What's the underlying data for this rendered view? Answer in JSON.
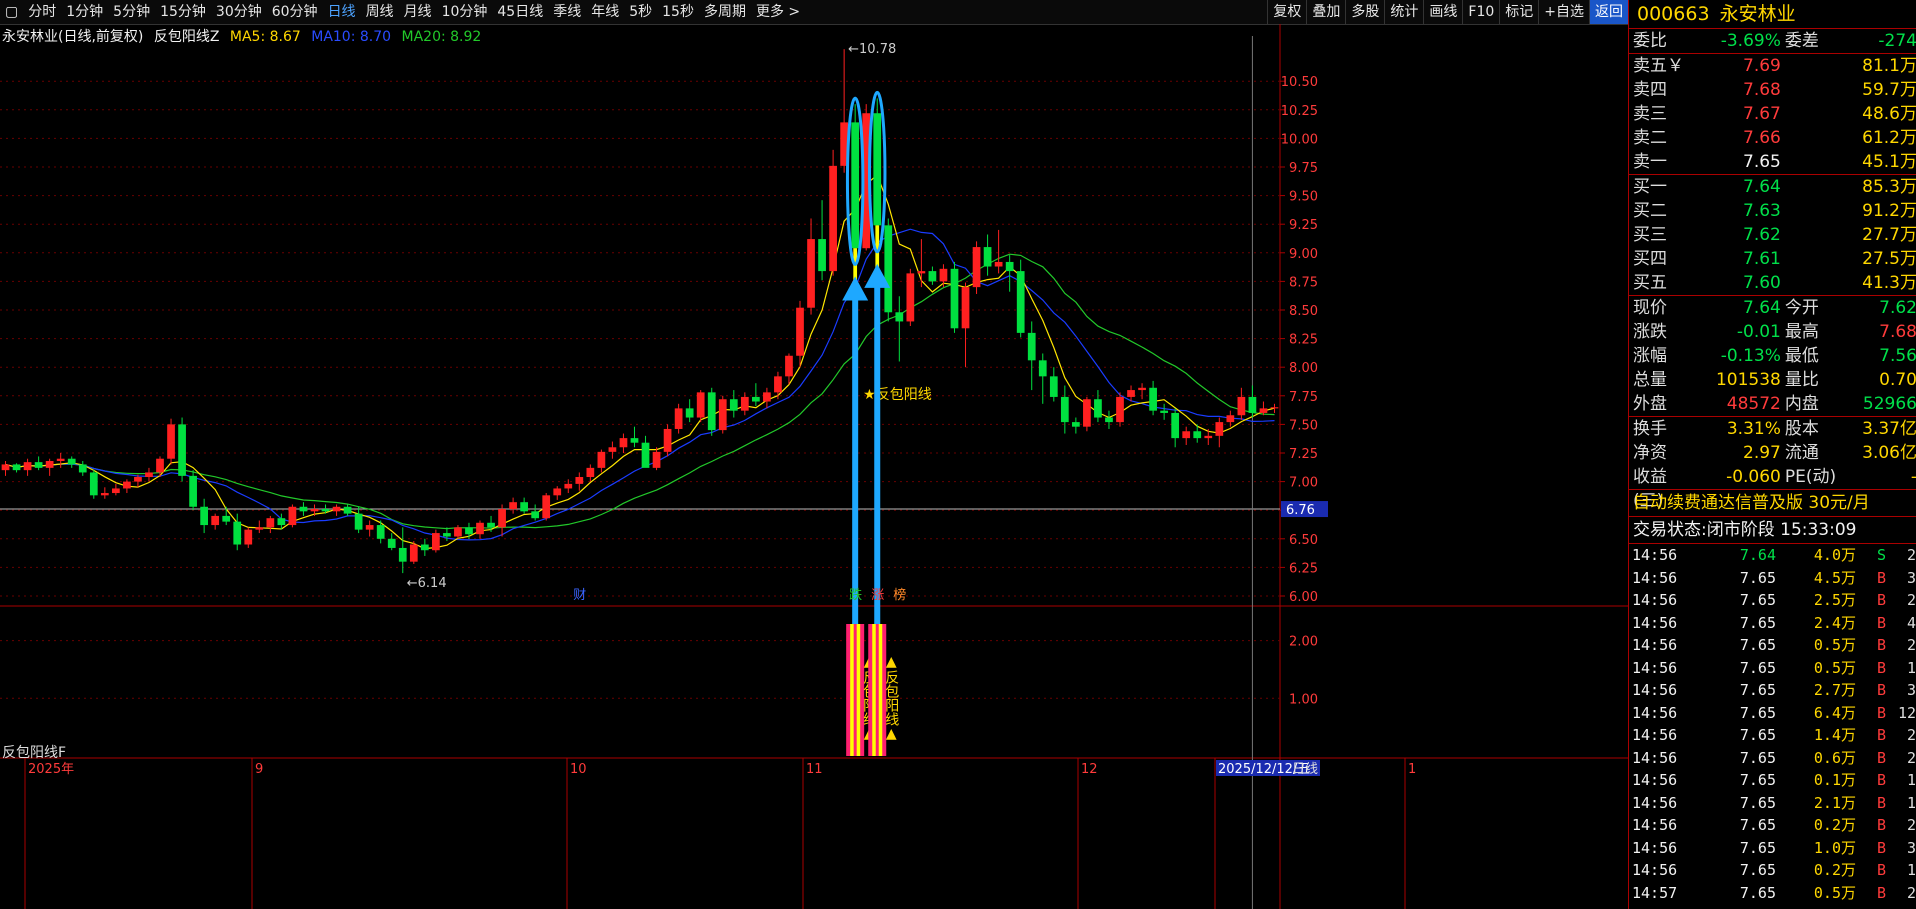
{
  "toolbar": {
    "menu_icon": "▢",
    "periods": [
      "分时",
      "1分钟",
      "5分钟",
      "15分钟",
      "30分钟",
      "60分钟",
      "日线",
      "周线",
      "月线",
      "10分钟",
      "45日线",
      "季线",
      "年线",
      "5秒",
      "15秒",
      "多周期",
      "更多 >"
    ],
    "active": "日线",
    "right": [
      "复权",
      "叠加",
      "多股",
      "统计",
      "画线",
      "F10",
      "标记",
      "+自选",
      "返回"
    ]
  },
  "chart_info": {
    "title": "永安林业(日线,前复权)",
    "indicator": "反包阳线Z",
    "ma5": "MA5: 8.67",
    "ma10": "MA10: 8.70",
    "ma20": "MA20: 8.92"
  },
  "sub_indicator": "反包阳线F",
  "colors": {
    "up": "#ff2020",
    "down": "#00e040",
    "ma5": "#ffe600",
    "ma10": "#1a3cff",
    "ma20": "#22c82a",
    "arrow": "#1ea8ff",
    "accent": "#ffd700"
  },
  "chart_data": {
    "type": "candlestick",
    "price_axis": [
      "10.50",
      "10.25",
      "10.00",
      "9.75",
      "9.50",
      "9.25",
      "9.00",
      "8.75",
      "8.50",
      "8.25",
      "8.00",
      "7.75",
      "7.50",
      "7.25",
      "7.00",
      "6.75",
      "6.50",
      "6.25",
      "6.00"
    ],
    "ylim": [
      5.93,
      11.0
    ],
    "sub_axis": [
      "2.00",
      "1.00"
    ],
    "high_label": "10.78",
    "low_label": "6.14",
    "crosshair_value": "6.76",
    "date_axis": [
      "2025年",
      "9",
      "10",
      "11",
      "12",
      "2025/12/12/五",
      "1"
    ],
    "period_label": "日线",
    "signal_label": "★反包阳线",
    "sub_signal_text": "▲反包阳线▲",
    "event_marks": [
      "财",
      "跌",
      "涨",
      "榜"
    ],
    "candles": [
      [
        7.1,
        7.18,
        7.05,
        7.15
      ],
      [
        7.15,
        7.16,
        7.08,
        7.1
      ],
      [
        7.1,
        7.2,
        7.05,
        7.17
      ],
      [
        7.17,
        7.22,
        7.1,
        7.12
      ],
      [
        7.12,
        7.2,
        7.05,
        7.18
      ],
      [
        7.18,
        7.25,
        7.12,
        7.2
      ],
      [
        7.2,
        7.22,
        7.12,
        7.15
      ],
      [
        7.15,
        7.18,
        7.05,
        7.08
      ],
      [
        7.08,
        7.1,
        6.85,
        6.88
      ],
      [
        6.88,
        6.95,
        6.85,
        6.9
      ],
      [
        6.9,
        6.98,
        6.88,
        6.94
      ],
      [
        6.94,
        7.02,
        6.9,
        7.0
      ],
      [
        7.0,
        7.06,
        6.95,
        7.04
      ],
      [
        7.04,
        7.12,
        7.0,
        7.08
      ],
      [
        7.08,
        7.22,
        7.04,
        7.2
      ],
      [
        7.2,
        7.55,
        7.15,
        7.5
      ],
      [
        7.5,
        7.56,
        7.0,
        7.05
      ],
      [
        7.05,
        7.1,
        6.75,
        6.78
      ],
      [
        6.78,
        6.85,
        6.55,
        6.62
      ],
      [
        6.62,
        6.72,
        6.58,
        6.7
      ],
      [
        6.7,
        6.78,
        6.62,
        6.65
      ],
      [
        6.65,
        6.72,
        6.4,
        6.45
      ],
      [
        6.45,
        6.6,
        6.42,
        6.58
      ],
      [
        6.58,
        6.66,
        6.55,
        6.6
      ],
      [
        6.6,
        6.7,
        6.55,
        6.68
      ],
      [
        6.68,
        6.72,
        6.58,
        6.62
      ],
      [
        6.62,
        6.8,
        6.6,
        6.78
      ],
      [
        6.78,
        6.82,
        6.7,
        6.74
      ],
      [
        6.74,
        6.8,
        6.7,
        6.76
      ],
      [
        6.76,
        6.8,
        6.72,
        6.74
      ],
      [
        6.74,
        6.8,
        6.7,
        6.78
      ],
      [
        6.78,
        6.8,
        6.7,
        6.72
      ],
      [
        6.72,
        6.78,
        6.55,
        6.58
      ],
      [
        6.58,
        6.66,
        6.52,
        6.62
      ],
      [
        6.62,
        6.66,
        6.46,
        6.5
      ],
      [
        6.5,
        6.55,
        6.4,
        6.42
      ],
      [
        6.42,
        6.6,
        6.2,
        6.3
      ],
      [
        6.3,
        6.48,
        6.28,
        6.45
      ],
      [
        6.45,
        6.5,
        6.35,
        6.4
      ],
      [
        6.4,
        6.58,
        6.38,
        6.55
      ],
      [
        6.55,
        6.6,
        6.48,
        6.52
      ],
      [
        6.52,
        6.62,
        6.5,
        6.6
      ],
      [
        6.6,
        6.64,
        6.5,
        6.54
      ],
      [
        6.54,
        6.66,
        6.5,
        6.64
      ],
      [
        6.64,
        6.7,
        6.56,
        6.6
      ],
      [
        6.6,
        6.8,
        6.52,
        6.76
      ],
      [
        6.76,
        6.86,
        6.72,
        6.82
      ],
      [
        6.82,
        6.86,
        6.72,
        6.74
      ],
      [
        6.74,
        6.8,
        6.66,
        6.68
      ],
      [
        6.68,
        6.9,
        6.66,
        6.88
      ],
      [
        6.88,
        6.96,
        6.84,
        6.94
      ],
      [
        6.94,
        7.02,
        6.9,
        6.98
      ],
      [
        6.98,
        7.08,
        6.92,
        7.04
      ],
      [
        7.04,
        7.15,
        7.0,
        7.12
      ],
      [
        7.12,
        7.28,
        7.08,
        7.26
      ],
      [
        7.26,
        7.35,
        7.2,
        7.3
      ],
      [
        7.3,
        7.42,
        7.25,
        7.38
      ],
      [
        7.38,
        7.48,
        7.3,
        7.34
      ],
      [
        7.34,
        7.4,
        7.15,
        7.12
      ],
      [
        7.12,
        7.3,
        7.1,
        7.26
      ],
      [
        7.26,
        7.5,
        7.22,
        7.46
      ],
      [
        7.46,
        7.68,
        7.42,
        7.64
      ],
      [
        7.64,
        7.72,
        7.52,
        7.56
      ],
      [
        7.56,
        7.8,
        7.52,
        7.78
      ],
      [
        7.78,
        7.82,
        7.4,
        7.45
      ],
      [
        7.45,
        7.75,
        7.42,
        7.72
      ],
      [
        7.72,
        7.8,
        7.56,
        7.62
      ],
      [
        7.62,
        7.78,
        7.58,
        7.74
      ],
      [
        7.74,
        7.86,
        7.66,
        7.7
      ],
      [
        7.7,
        7.82,
        7.64,
        7.78
      ],
      [
        7.78,
        7.96,
        7.72,
        7.92
      ],
      [
        7.92,
        8.12,
        7.85,
        8.1
      ],
      [
        8.1,
        8.58,
        8.0,
        8.52
      ],
      [
        8.52,
        9.3,
        8.46,
        9.12
      ],
      [
        9.12,
        9.46,
        8.76,
        8.84
      ],
      [
        8.84,
        9.9,
        8.8,
        9.76
      ],
      [
        9.76,
        10.78,
        9.7,
        10.14
      ],
      [
        10.14,
        10.3,
        8.95,
        9.04
      ],
      [
        9.04,
        10.3,
        9.02,
        10.22
      ],
      [
        10.22,
        10.35,
        9.06,
        9.24
      ],
      [
        9.24,
        9.3,
        8.4,
        8.48
      ],
      [
        8.48,
        8.62,
        8.05,
        8.4
      ],
      [
        8.4,
        8.86,
        8.36,
        8.82
      ],
      [
        8.82,
        9.12,
        8.7,
        8.84
      ],
      [
        8.84,
        8.88,
        8.72,
        8.75
      ],
      [
        8.75,
        8.9,
        8.7,
        8.86
      ],
      [
        8.86,
        8.92,
        8.3,
        8.34
      ],
      [
        8.34,
        8.74,
        8.0,
        8.7
      ],
      [
        8.7,
        9.1,
        8.64,
        9.05
      ],
      [
        9.05,
        9.16,
        8.8,
        8.88
      ],
      [
        8.88,
        9.2,
        8.82,
        8.92
      ],
      [
        8.92,
        8.98,
        8.66,
        8.84
      ],
      [
        8.84,
        8.94,
        8.26,
        8.3
      ],
      [
        8.3,
        8.4,
        7.8,
        8.06
      ],
      [
        8.06,
        8.12,
        7.68,
        7.92
      ],
      [
        7.92,
        8.0,
        7.7,
        7.74
      ],
      [
        7.74,
        7.84,
        7.42,
        7.52
      ],
      [
        7.52,
        7.56,
        7.42,
        7.48
      ],
      [
        7.48,
        7.74,
        7.44,
        7.72
      ],
      [
        7.72,
        7.8,
        7.52,
        7.56
      ],
      [
        7.56,
        7.62,
        7.46,
        7.52
      ],
      [
        7.52,
        7.78,
        7.48,
        7.74
      ],
      [
        7.74,
        7.84,
        7.7,
        7.8
      ],
      [
        7.8,
        7.86,
        7.72,
        7.82
      ],
      [
        7.82,
        7.88,
        7.58,
        7.62
      ],
      [
        7.62,
        7.68,
        7.54,
        7.6
      ],
      [
        7.6,
        7.64,
        7.3,
        7.38
      ],
      [
        7.38,
        7.48,
        7.32,
        7.44
      ],
      [
        7.44,
        7.5,
        7.34,
        7.38
      ],
      [
        7.38,
        7.46,
        7.32,
        7.4
      ],
      [
        7.4,
        7.56,
        7.3,
        7.52
      ],
      [
        7.52,
        7.62,
        7.48,
        7.58
      ],
      [
        7.58,
        7.82,
        7.54,
        7.74
      ],
      [
        7.74,
        7.84,
        7.56,
        7.6
      ],
      [
        7.6,
        7.7,
        7.58,
        7.64
      ],
      [
        7.64,
        7.68,
        7.6,
        7.65
      ]
    ]
  },
  "quote": {
    "code": "000663",
    "name": "永安林业",
    "weibi_label": "委比",
    "weibi": "-3.69%",
    "weicha_label": "委差",
    "weicha": "-274",
    "asks": [
      {
        "label": "卖五￥",
        "price": "7.69",
        "vol": "81.1万",
        "cls": "red"
      },
      {
        "label": "卖四",
        "price": "7.68",
        "vol": "59.7万",
        "cls": "red"
      },
      {
        "label": "卖三",
        "price": "7.67",
        "vol": "48.6万",
        "cls": "red"
      },
      {
        "label": "卖二",
        "price": "7.66",
        "vol": "61.2万",
        "cls": "red"
      },
      {
        "label": "卖一",
        "price": "7.65",
        "vol": "45.1万",
        "cls": "white"
      }
    ],
    "bids": [
      {
        "label": "买一",
        "price": "7.64",
        "vol": "85.3万",
        "cls": "green"
      },
      {
        "label": "买二",
        "price": "7.63",
        "vol": "91.2万",
        "cls": "green"
      },
      {
        "label": "买三",
        "price": "7.62",
        "vol": "27.7万",
        "cls": "green"
      },
      {
        "label": "买四",
        "price": "7.61",
        "vol": "27.5万",
        "cls": "green"
      },
      {
        "label": "买五",
        "price": "7.60",
        "vol": "41.3万",
        "cls": "green"
      }
    ],
    "stats": [
      {
        "l1": "现价",
        "v1": "7.64",
        "c1": "green",
        "l2": "今开",
        "v2": "7.62",
        "c2": "green"
      },
      {
        "l1": "涨跌",
        "v1": "-0.01",
        "c1": "green",
        "l2": "最高",
        "v2": "7.68",
        "c2": "red"
      },
      {
        "l1": "涨幅",
        "v1": "-0.13%",
        "c1": "green",
        "l2": "最低",
        "v2": "7.56",
        "c2": "green"
      },
      {
        "l1": "总量",
        "v1": "101538",
        "c1": "yellow",
        "l2": "量比",
        "v2": "0.70",
        "c2": "yellow"
      },
      {
        "l1": "外盘",
        "v1": "48572",
        "c1": "red",
        "l2": "内盘",
        "v2": "52966",
        "c2": "green"
      }
    ],
    "stats2": [
      {
        "l1": "换手",
        "v1": "3.31%",
        "c1": "yellow",
        "l2": "股本",
        "v2": "3.37亿",
        "c2": "yellow"
      },
      {
        "l1": "净资",
        "v1": "2.97",
        "c1": "yellow",
        "l2": "流通",
        "v2": "3.06亿",
        "c2": "yellow"
      },
      {
        "l1": "收益(三)",
        "v1": "-0.060",
        "c1": "yellow",
        "l2": "PE(动)",
        "v2": "-",
        "c2": "yellow"
      }
    ],
    "notice": "自动续费通达信普及版  30元/月",
    "state": "交易状态:闭市阶段 15:33:09",
    "ticks": [
      {
        "t": "14:56",
        "p": "7.64",
        "pc": "green",
        "v": "4.0万",
        "s": "S",
        "sc": "green",
        "n": "2"
      },
      {
        "t": "14:56",
        "p": "7.65",
        "pc": "white",
        "v": "4.5万",
        "s": "B",
        "sc": "red",
        "n": "3"
      },
      {
        "t": "14:56",
        "p": "7.65",
        "pc": "white",
        "v": "2.5万",
        "s": "B",
        "sc": "red",
        "n": "2"
      },
      {
        "t": "14:56",
        "p": "7.65",
        "pc": "white",
        "v": "2.4万",
        "s": "B",
        "sc": "red",
        "n": "4"
      },
      {
        "t": "14:56",
        "p": "7.65",
        "pc": "white",
        "v": "0.5万",
        "s": "B",
        "sc": "red",
        "n": "2"
      },
      {
        "t": "14:56",
        "p": "7.65",
        "pc": "white",
        "v": "0.5万",
        "s": "B",
        "sc": "red",
        "n": "1"
      },
      {
        "t": "14:56",
        "p": "7.65",
        "pc": "white",
        "v": "2.7万",
        "s": "B",
        "sc": "red",
        "n": "3"
      },
      {
        "t": "14:56",
        "p": "7.65",
        "pc": "white",
        "v": "6.4万",
        "s": "B",
        "sc": "red",
        "n": "12"
      },
      {
        "t": "14:56",
        "p": "7.65",
        "pc": "white",
        "v": "1.4万",
        "s": "B",
        "sc": "red",
        "n": "2"
      },
      {
        "t": "14:56",
        "p": "7.65",
        "pc": "white",
        "v": "0.6万",
        "s": "B",
        "sc": "red",
        "n": "2"
      },
      {
        "t": "14:56",
        "p": "7.65",
        "pc": "white",
        "v": "0.1万",
        "s": "B",
        "sc": "red",
        "n": "1"
      },
      {
        "t": "14:56",
        "p": "7.65",
        "pc": "white",
        "v": "2.1万",
        "s": "B",
        "sc": "red",
        "n": "1"
      },
      {
        "t": "14:56",
        "p": "7.65",
        "pc": "white",
        "v": "0.2万",
        "s": "B",
        "sc": "red",
        "n": "2"
      },
      {
        "t": "14:56",
        "p": "7.65",
        "pc": "white",
        "v": "1.0万",
        "s": "B",
        "sc": "red",
        "n": "3"
      },
      {
        "t": "14:56",
        "p": "7.65",
        "pc": "white",
        "v": "0.2万",
        "s": "B",
        "sc": "red",
        "n": "1"
      },
      {
        "t": "14:57",
        "p": "7.65",
        "pc": "white",
        "v": "0.5万",
        "s": "B",
        "sc": "red",
        "n": "2"
      }
    ]
  }
}
